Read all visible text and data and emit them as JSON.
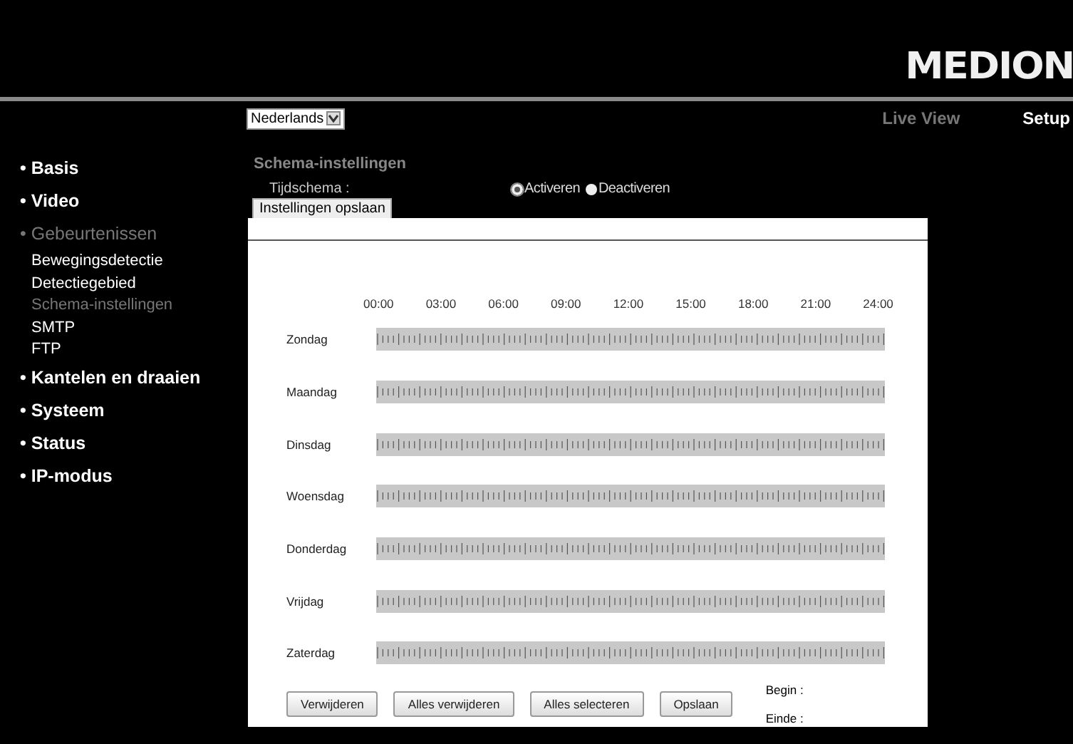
{
  "logo": "MEDION",
  "language": {
    "value": "Nederlands"
  },
  "nav": [
    {
      "label": "Live View",
      "selected": false
    },
    {
      "label": "Setup",
      "selected": true
    }
  ],
  "sidebar": {
    "items": [
      {
        "label": "• Basis",
        "expanded": false
      },
      {
        "label": "• Video",
        "expanded": false
      },
      {
        "label": "• Gebeurtenissen",
        "expanded": true,
        "children": [
          {
            "label": "Bewegingsdetectie",
            "selected": false
          },
          {
            "label": "Detectiegebied",
            "selected": false
          },
          {
            "label": "Schema-instellingen",
            "selected": true
          },
          {
            "label": "SMTP",
            "selected": false
          },
          {
            "label": "FTP",
            "selected": false
          }
        ]
      },
      {
        "label": "• Kantelen en draaien",
        "expanded": false
      },
      {
        "label": "• Systeem",
        "expanded": false
      },
      {
        "label": "• Status",
        "expanded": false
      },
      {
        "label": "• IP-modus",
        "expanded": false
      }
    ]
  },
  "section_title": "Schema-instellingen",
  "schedule_label": "Tijdschema :",
  "schedule_options": [
    {
      "label": "Activeren",
      "selected": true
    },
    {
      "label": "Deactiveren",
      "selected": false
    }
  ],
  "save_settings_button": "Instellingen opslaan",
  "hours": [
    "00:00",
    "03:00",
    "06:00",
    "09:00",
    "12:00",
    "15:00",
    "18:00",
    "21:00",
    "24:00"
  ],
  "days": [
    "Zondag",
    "Maandag",
    "Dinsdag",
    "Woensdag",
    "Donderdag",
    "Vrijdag",
    "Zaterdag"
  ],
  "buttons": [
    "Verwijderen",
    "Alles verwijderen",
    "Alles selecteren",
    "Opslaan"
  ],
  "begin_label": "Begin :",
  "end_label": "Einde :"
}
